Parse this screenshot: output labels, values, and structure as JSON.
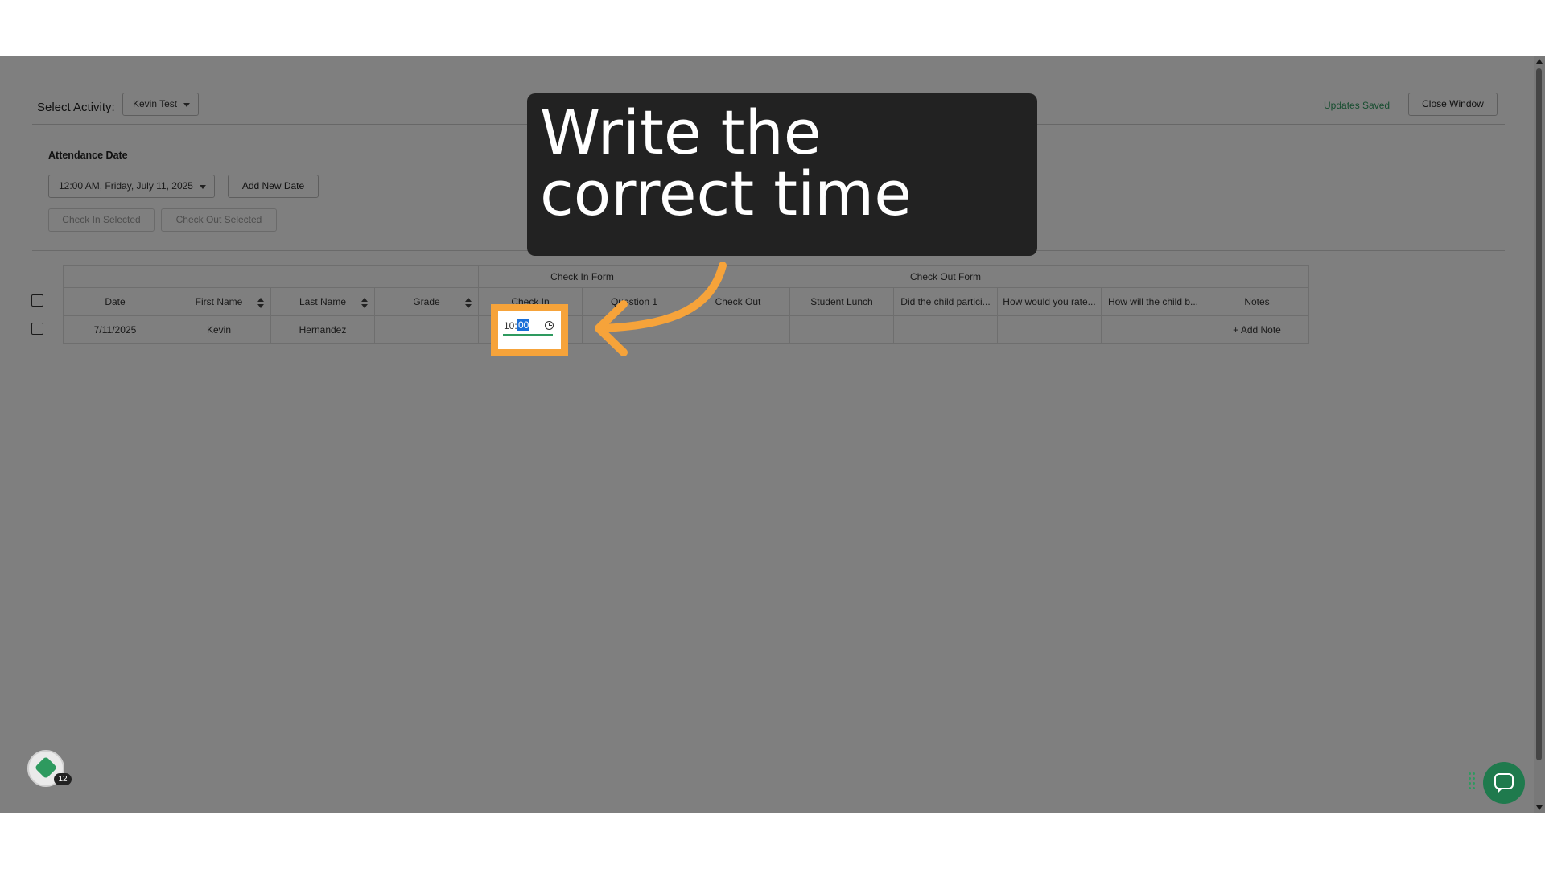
{
  "header": {
    "select_activity_label": "Select Activity:",
    "activity_value": "Kevin Test",
    "status_text": "Updates Saved",
    "close_label": "Close Window"
  },
  "attendance": {
    "label": "Attendance Date",
    "date_value": "12:00 AM, Friday, July 11, 2025",
    "add_new_date_label": "Add New Date",
    "check_in_selected_label": "Check In Selected",
    "check_out_selected_label": "Check Out Selected"
  },
  "table": {
    "groups": {
      "check_in_form": "Check In Form",
      "check_out_form": "Check Out Form"
    },
    "headers": [
      "Date",
      "First Name",
      "Last Name",
      "Grade",
      "Check In",
      "Question 1",
      "Check Out",
      "Student Lunch",
      "Did the child partici...",
      "How would you rate...",
      "How will the child b...",
      "Notes"
    ],
    "rows": [
      {
        "date": "7/11/2025",
        "first_name": "Kevin",
        "last_name": "Hernandez",
        "grade": "",
        "check_in_hour": "10:",
        "check_in_minute": "00",
        "add_note_label": "+ Add Note"
      }
    ]
  },
  "callout": {
    "line1": "Write the",
    "line2": "correct time"
  },
  "widgets": {
    "badge_count": "12"
  },
  "colors": {
    "accent_green": "#2e9a5f",
    "highlight_orange": "#f6a33a",
    "callout_bg": "#222222",
    "selection_blue": "#1a6fd8"
  },
  "icons": {
    "time_field": "clock-icon",
    "chat": "chat-bubble-icon",
    "launcher": "app-launcher-icon"
  }
}
